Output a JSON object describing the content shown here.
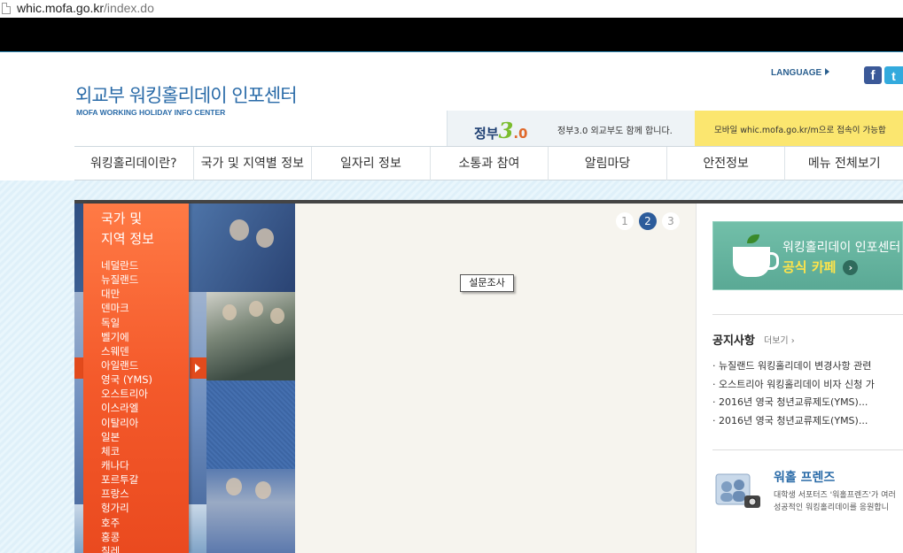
{
  "browser": {
    "url_host": "whic.mofa.go.kr",
    "url_path": "/index.do"
  },
  "header": {
    "logo_kr": "외교부 워킹홀리데이 인포센터",
    "logo_en": "MOFA WORKING HOLIDAY INFO CENTER",
    "language": "LANGUAGE",
    "facebook_glyph": "f",
    "twitter_glyph": "t"
  },
  "gov_banner": {
    "logo_prefix": "정부",
    "logo_number": "3",
    "logo_suffix": ".0",
    "text": "정부3.0 외교부도 함께 합니다."
  },
  "mobile_banner": {
    "text": "모바일 whic.mofa.go.kr/m으로 접속이 가능합"
  },
  "nav": {
    "items": [
      {
        "label": "워킹홀리데이란?"
      },
      {
        "label": "국가 및 지역별 정보"
      },
      {
        "label": "일자리 정보"
      },
      {
        "label": "소통과 참여"
      },
      {
        "label": "알림마당"
      },
      {
        "label": "안전정보"
      },
      {
        "label": "메뉴 전체보기"
      }
    ]
  },
  "country_menu": {
    "title_line1": "국가 및",
    "title_line2": "지역 정보",
    "countries": [
      "네덜란드",
      "뉴질랜드",
      "대만",
      "덴마크",
      "독일",
      "벨기에",
      "스웨덴",
      "아일랜드",
      "영국 (YMS)",
      "오스트리아",
      "이스라엘",
      "이탈리아",
      "일본",
      "체코",
      "캐나다",
      "포르투갈",
      "프랑스",
      "헝가리",
      "호주",
      "홍콩",
      "칠레"
    ]
  },
  "slider": {
    "pages": [
      "1",
      "2",
      "3"
    ],
    "active_page": "2",
    "survey_label": "설문조사"
  },
  "sidebar": {
    "cafe_line1": "워킹홀리데이 인포센터",
    "cafe_line2": "공식 카페",
    "cafe_go": "›",
    "notice_title": "공지사항",
    "notice_more": "더보기 ›",
    "notices": [
      "· 뉴질랜드 워킹홀리데이 변경사항 관련",
      "· 오스트리아 워킹홀리데이 비자 신청 가",
      "· 2016년 영국 청년교류제도(YMS)...",
      "· 2016년 영국 청년교류제도(YMS)..."
    ],
    "friends_title": "워홀 프렌즈",
    "friends_desc1": "대학생 서포터즈 '워홀프렌즈'가 여러",
    "friends_desc2": "성공적인 워킹홀리데이를 응원합니"
  },
  "colors": {
    "brand_blue": "#2a6ba8",
    "accent_orange": "#f45a2b",
    "cafe_green": "#5aa995",
    "mobile_yellow": "#fbe66f"
  }
}
